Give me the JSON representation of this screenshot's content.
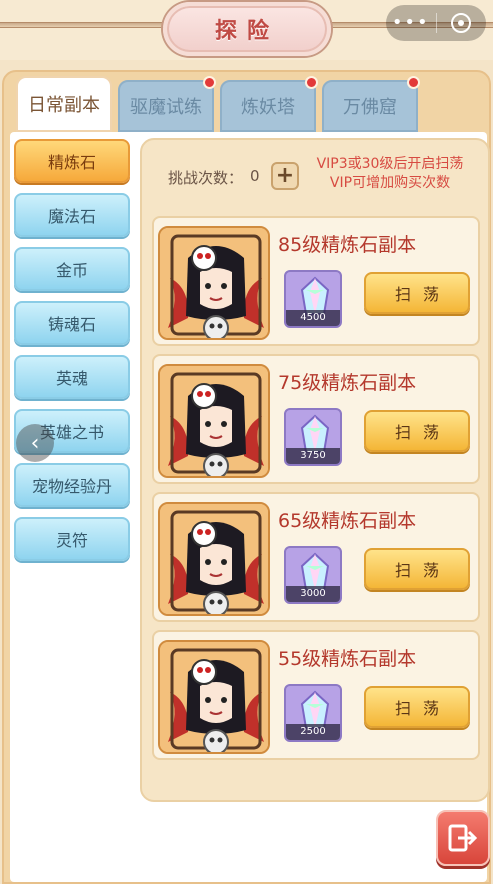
{
  "header": {
    "title": "探险",
    "more_icon": "more-dots-icon",
    "close_icon": "close-target-icon"
  },
  "tabs": [
    {
      "label": "日常副本",
      "active": true,
      "badge": false
    },
    {
      "label": "驱魔试练",
      "active": false,
      "badge": true
    },
    {
      "label": "炼妖塔",
      "active": false,
      "badge": true
    },
    {
      "label": "万佛窟",
      "active": false,
      "badge": true
    }
  ],
  "side_menu": [
    {
      "label": "精炼石",
      "active": true
    },
    {
      "label": "魔法石",
      "active": false
    },
    {
      "label": "金币",
      "active": false
    },
    {
      "label": "铸魂石",
      "active": false
    },
    {
      "label": "英魂",
      "active": false
    },
    {
      "label": "英雄之书",
      "active": false
    },
    {
      "label": "宠物经验丹",
      "active": false
    },
    {
      "label": "灵符",
      "active": false
    }
  ],
  "challenge": {
    "label": "挑战次数：",
    "count": "0",
    "plus": "+",
    "vip_note_line1": "VIP3或30级后开启扫荡",
    "vip_note_line2": "VIP可增加购买次数"
  },
  "dungeons": [
    {
      "title": "85级精炼石副本",
      "reward_qty": "4500",
      "button": "扫荡"
    },
    {
      "title": "75级精炼石副本",
      "reward_qty": "3750",
      "button": "扫荡"
    },
    {
      "title": "65级精炼石副本",
      "reward_qty": "3000",
      "button": "扫荡"
    },
    {
      "title": "55级精炼石副本",
      "reward_qty": "2500",
      "button": "扫荡"
    }
  ],
  "colors": {
    "accent_red": "#c04a44",
    "side_active": "#f6a93b",
    "side_inactive": "#8fd4ef",
    "sweep_button": "#f4b637",
    "exit_button": "#d8453b"
  }
}
